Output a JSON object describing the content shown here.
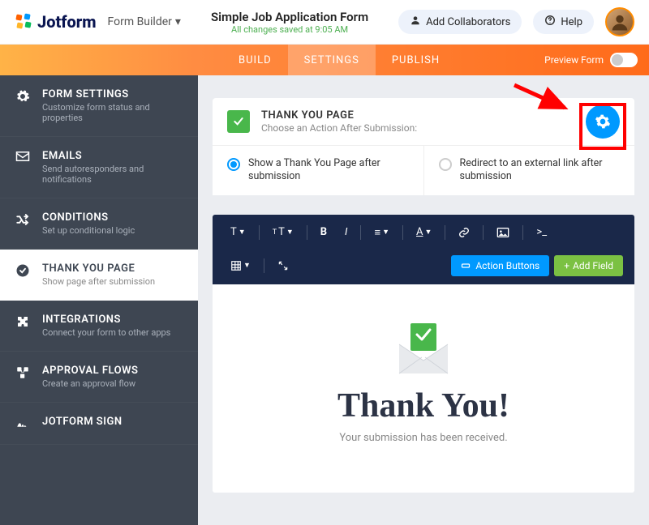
{
  "header": {
    "brand": "Jotform",
    "form_builder_label": "Form Builder",
    "form_title": "Simple Job Application Form",
    "saved_msg": "All changes saved at 9:05 AM",
    "add_collab": "Add Collaborators",
    "help": "Help"
  },
  "tabs": {
    "build": "BUILD",
    "settings": "SETTINGS",
    "publish": "PUBLISH",
    "preview": "Preview Form"
  },
  "sidebar": [
    {
      "label": "FORM SETTINGS",
      "desc": "Customize form status and properties"
    },
    {
      "label": "EMAILS",
      "desc": "Send autoresponders and notifications"
    },
    {
      "label": "CONDITIONS",
      "desc": "Set up conditional logic"
    },
    {
      "label": "THANK YOU PAGE",
      "desc": "Show page after submission"
    },
    {
      "label": "INTEGRATIONS",
      "desc": "Connect your form to other apps"
    },
    {
      "label": "APPROVAL FLOWS",
      "desc": "Create an approval flow"
    },
    {
      "label": "JOTFORM SIGN",
      "desc": ""
    }
  ],
  "panel": {
    "title": "THANK YOU PAGE",
    "subtitle": "Choose an Action After Submission:"
  },
  "options": {
    "show": "Show a Thank You Page after submission",
    "redirect": "Redirect to an external link after submission"
  },
  "toolbar": {
    "action_buttons": "Action Buttons",
    "add_field": "Add Field"
  },
  "thankyou": {
    "heading": "Thank You!",
    "sub": "Your submission has been received."
  }
}
